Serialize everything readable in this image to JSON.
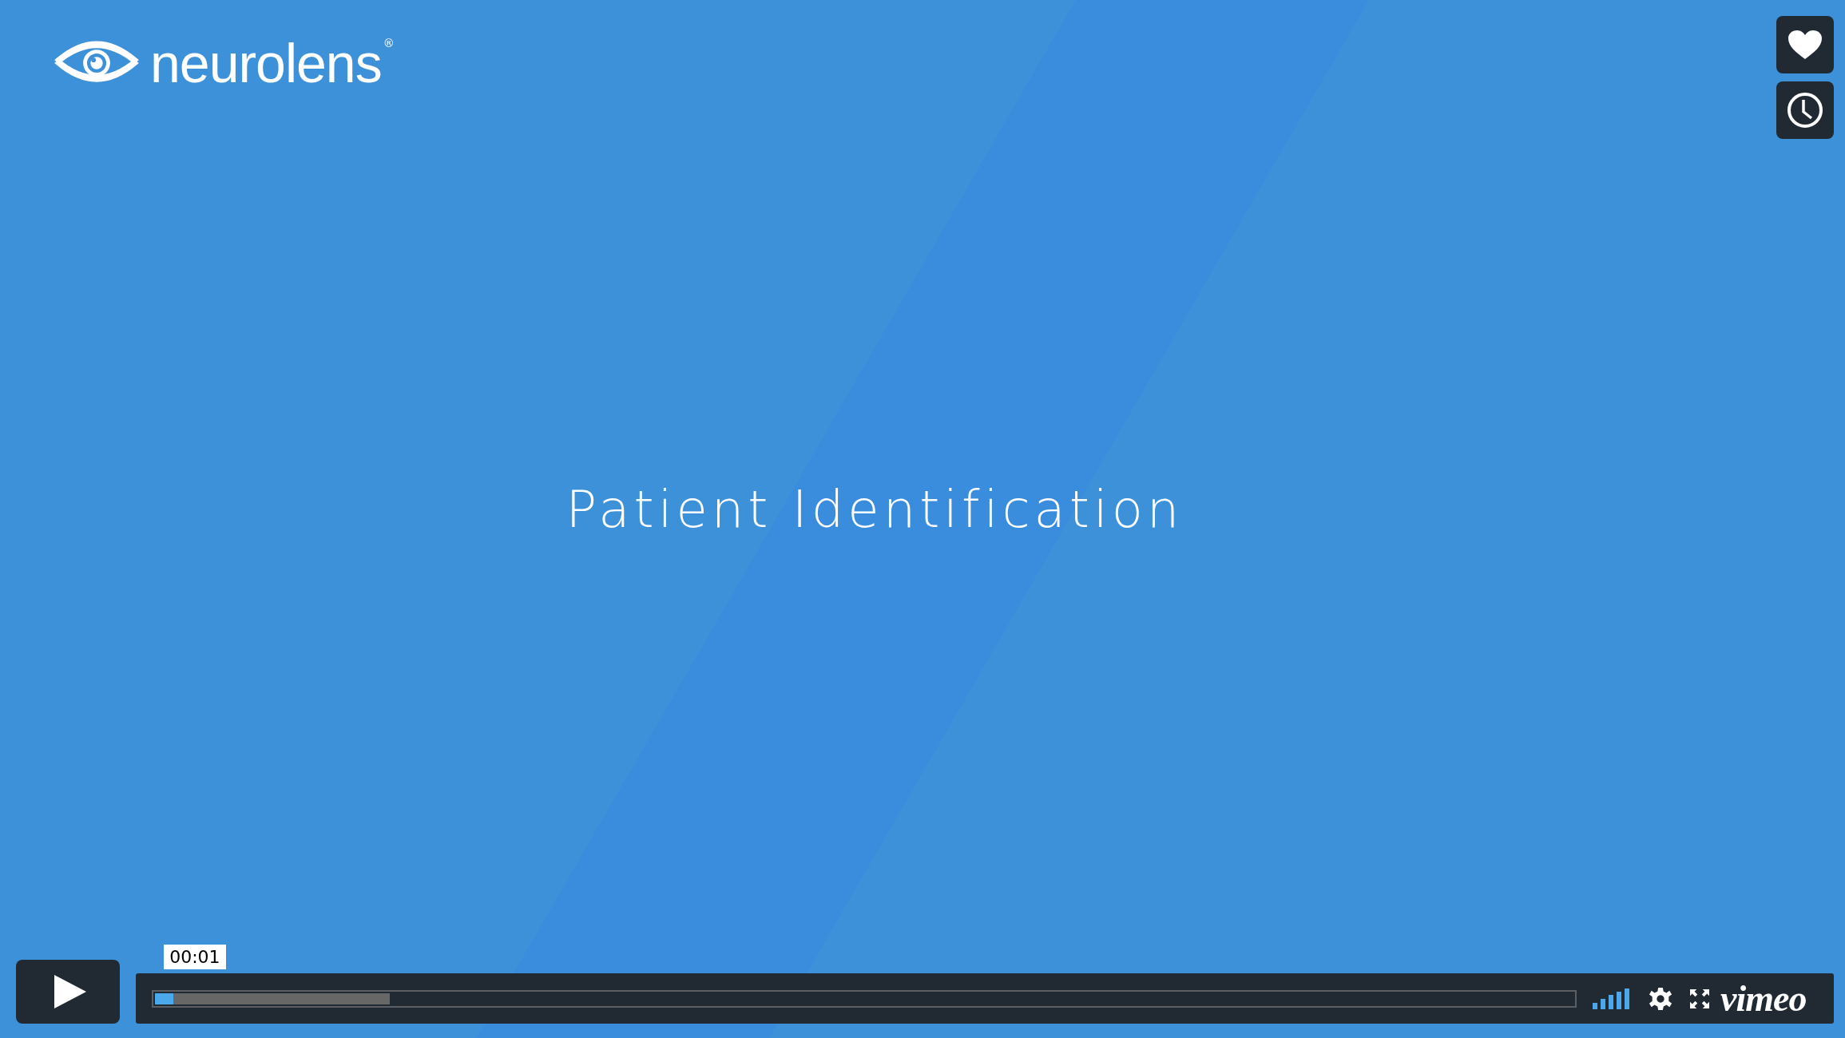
{
  "video": {
    "logo": {
      "name": "neurolens",
      "mark": "®"
    },
    "title": "Patient Identification"
  },
  "side_buttons": [
    {
      "kind": "like"
    },
    {
      "kind": "watch_later"
    }
  ],
  "controls": {
    "playing": false,
    "time_tooltip": "00:01",
    "played": {
      "level": 0.013
    },
    "loaded": {
      "level": 0.165
    },
    "brand": "vimeo"
  }
}
